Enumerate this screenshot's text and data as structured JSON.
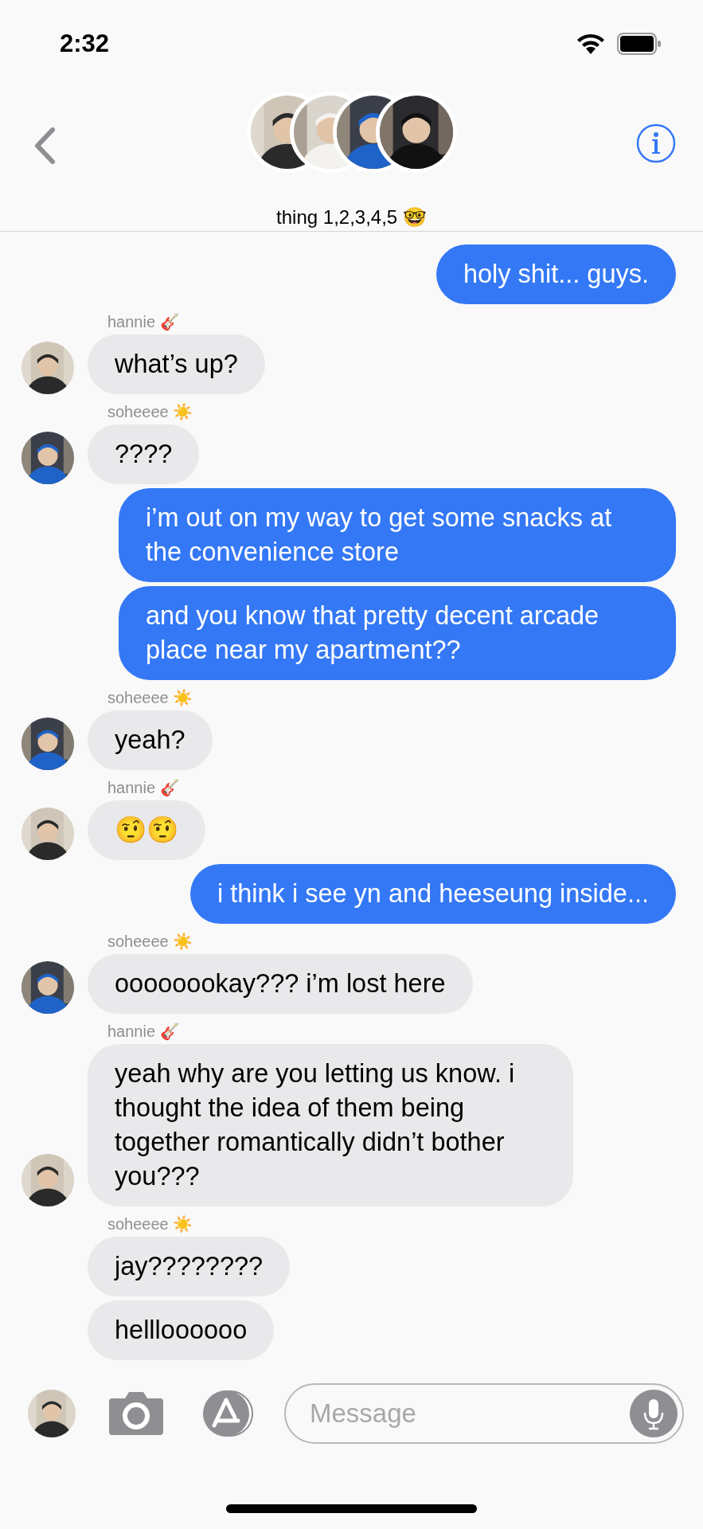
{
  "status_bar": {
    "time": "2:32"
  },
  "header": {
    "title": "thing 1,2,3,4,5 🤓"
  },
  "messages": [
    {
      "kind": "sent",
      "text": "holy shit... guys."
    },
    {
      "kind": "received",
      "sender": "hannie 🎸",
      "text": "what’s up?",
      "avatar": true
    },
    {
      "kind": "received",
      "sender": "soheeee ☀️",
      "text": "????",
      "avatar": true
    },
    {
      "kind": "sent",
      "text": "i’m out on my way to get some snacks at the convenience store"
    },
    {
      "kind": "sent",
      "text": "and you know that pretty decent arcade place near my apartment??"
    },
    {
      "kind": "received",
      "sender": "soheeee ☀️",
      "text": "yeah?",
      "avatar": true
    },
    {
      "kind": "received",
      "sender": "hannie 🎸",
      "text": "🤨🤨",
      "avatar": true
    },
    {
      "kind": "sent",
      "text": "i think i see yn and heeseung inside..."
    },
    {
      "kind": "received",
      "sender": "soheeee ☀️",
      "text": "oooooookay??? i’m lost here",
      "avatar": true
    },
    {
      "kind": "received",
      "sender": "hannie 🎸",
      "text": "yeah why are you letting us know. i thought the idea of them being together romantically didn’t bother you???",
      "avatar": true
    },
    {
      "kind": "received",
      "sender": "soheeee ☀️",
      "text": "jay????????",
      "avatar": false
    },
    {
      "kind": "received",
      "text": "hellloooooo",
      "avatar": false
    }
  ],
  "composer": {
    "placeholder": "Message"
  }
}
